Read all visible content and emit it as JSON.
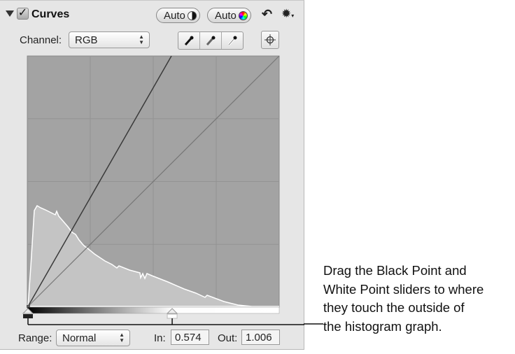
{
  "header": {
    "title": "Curves",
    "auto_contrast_label": "Auto",
    "auto_color_label": "Auto",
    "checked": true
  },
  "channel": {
    "label": "Channel:",
    "value": "RGB"
  },
  "range": {
    "label": "Range:",
    "value": "Normal"
  },
  "readouts": {
    "in_label": "In:",
    "in_value": "0.574",
    "out_label": "Out:",
    "out_value": "1.006"
  },
  "sliders": {
    "black_point": 0.0,
    "white_point": 0.574
  },
  "callout": {
    "lines": [
      "Drag the Black Point and",
      "White Point sliders to where",
      "they touch the outside of",
      "the histogram graph."
    ]
  },
  "colors": {
    "graph_bg": "#a3a3a3",
    "histogram_fill": "#c4c4c4",
    "grid": "#8f8f8f"
  }
}
